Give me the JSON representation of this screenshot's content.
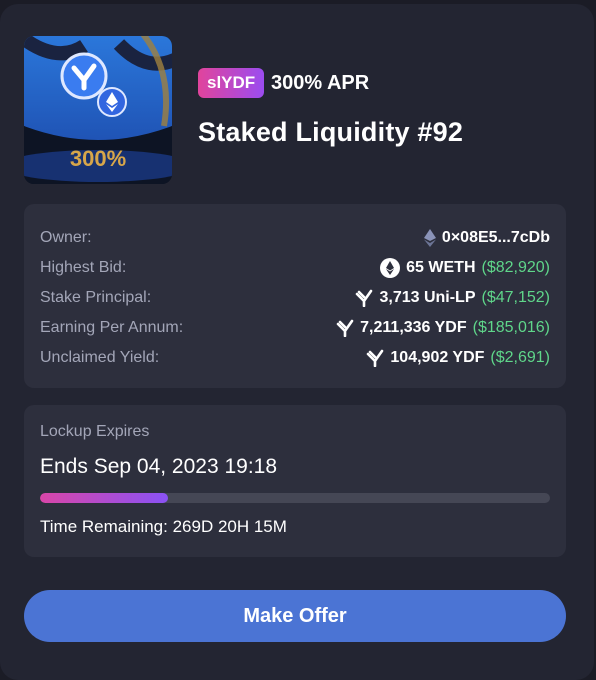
{
  "nft": {
    "image_label": "300%",
    "badge": "slYDF",
    "apr": "300% APR",
    "title": "Staked Liquidity #92"
  },
  "details": [
    {
      "label": "Owner:",
      "icon": "eth-diamond-icon",
      "value": "0×08E5...7cDb",
      "usd": ""
    },
    {
      "label": "Highest Bid:",
      "icon": "weth-icon",
      "value": "65 WETH",
      "usd": "($82,920)"
    },
    {
      "label": "Stake Principal:",
      "icon": "ydf-logo-icon",
      "value": "3,713 Uni-LP",
      "usd": "($47,152)"
    },
    {
      "label": "Earning Per Annum:",
      "icon": "ydf-logo-icon",
      "value": "7,211,336 YDF",
      "usd": "($185,016)"
    },
    {
      "label": "Unclaimed Yield:",
      "icon": "ydf-logo-icon",
      "value": "104,902 YDF",
      "usd": "($2,691)"
    }
  ],
  "lockup": {
    "label": "Lockup Expires",
    "ends": "Ends Sep 04, 2023 19:18",
    "progress": 0.25,
    "remaining": "Time Remaining: 269D 20H 15M"
  },
  "action": {
    "make_offer": "Make Offer"
  },
  "colors": {
    "background": "#1b1c26",
    "card": "#232532",
    "panel": "#2d2f3d",
    "accent_blue": "#4b74d4",
    "usd_green": "#5fd68a",
    "gradient_start": "#d946a8",
    "gradient_end": "#8a52f5"
  }
}
